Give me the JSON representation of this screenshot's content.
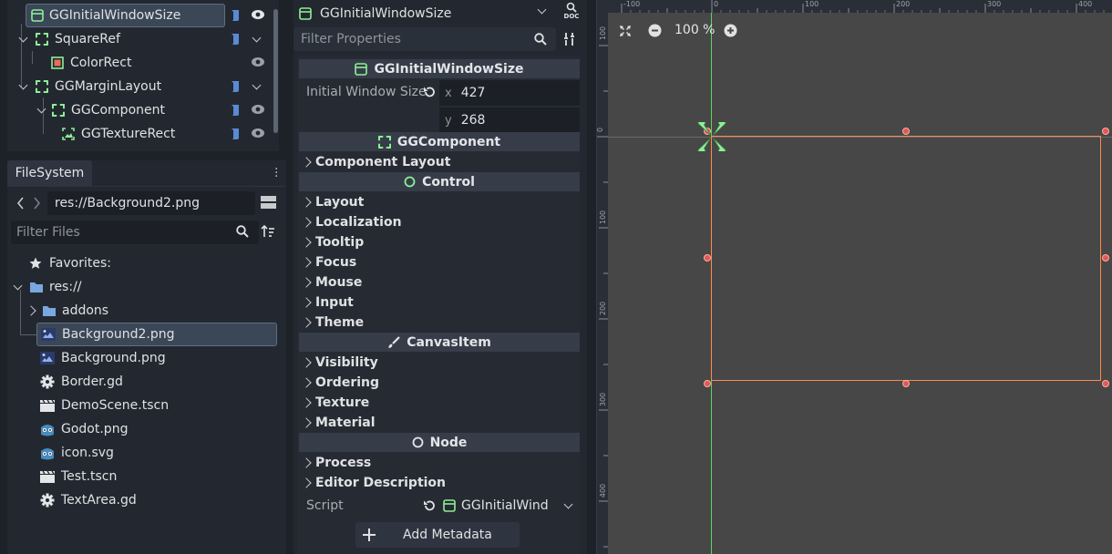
{
  "scene_tree": {
    "nodes": [
      {
        "label": "GGInitialWindowSize",
        "icon": "control-window-icon",
        "script": true,
        "visibility": "visible",
        "selected": true
      },
      {
        "label": "SquareRef",
        "icon": "ggcomponent-icon",
        "script": true,
        "fold": "collapsed"
      },
      {
        "label": "ColorRect",
        "icon": "colorrect-icon",
        "script": false,
        "visibility": "visible"
      },
      {
        "label": "GGMarginLayout",
        "icon": "ggcomponent-icon",
        "script": true,
        "fold": "collapsed"
      },
      {
        "label": "GGComponent",
        "icon": "ggcomponent-icon",
        "script": true,
        "visibility": "visible"
      },
      {
        "label": "GGTextureRect",
        "icon": "texturerect-icon",
        "script": true,
        "visibility": "visible"
      }
    ]
  },
  "filesystem": {
    "tab": "FileSystem",
    "path": "res://Background2.png",
    "filter_placeholder": "Filter Files",
    "favorites": "Favorites:",
    "root": "res://",
    "items": [
      {
        "label": "addons",
        "icon": "folder-icon"
      },
      {
        "label": "Background2.png",
        "icon": "image-icon",
        "selected": true
      },
      {
        "label": "Background.png",
        "icon": "image-icon"
      },
      {
        "label": "Border.gd",
        "icon": "gear-icon"
      },
      {
        "label": "DemoScene.tscn",
        "icon": "clapper-icon"
      },
      {
        "label": "Godot.png",
        "icon": "godot-icon"
      },
      {
        "label": "icon.svg",
        "icon": "godot-icon"
      },
      {
        "label": "Test.tscn",
        "icon": "clapper-icon"
      },
      {
        "label": "TextArea.gd",
        "icon": "gear-icon"
      }
    ]
  },
  "inspector": {
    "object": "GGInitialWindowSize",
    "doc_label": "DOC",
    "filter_placeholder": "Filter Properties",
    "section_main": "GGInitialWindowSize",
    "initial_window_size_label": "Initial Window Size",
    "size_x_label": "x",
    "size_x": "427",
    "size_y_label": "y",
    "size_y": "268",
    "section_ggcomponent": "GGComponent",
    "group_component_layout": "Component Layout",
    "section_control": "Control",
    "control_groups": [
      "Layout",
      "Localization",
      "Tooltip",
      "Focus",
      "Mouse",
      "Input",
      "Theme"
    ],
    "section_canvasitem": "CanvasItem",
    "canvas_groups": [
      "Visibility",
      "Ordering",
      "Texture",
      "Material"
    ],
    "section_node": "Node",
    "node_groups": [
      "Process",
      "Editor Description"
    ],
    "script_label": "Script",
    "script_value": "GGInitialWind",
    "add_metadata": "Add Metadata"
  },
  "viewport": {
    "zoom": "100 %",
    "ruler_top": [
      "-100",
      "0",
      "100",
      "200",
      "300",
      "400"
    ],
    "ruler_left": [
      "100",
      "0",
      "100",
      "200",
      "300",
      "400"
    ]
  },
  "colors": {
    "accent": "#4a90d9",
    "node_green": "#8eef97",
    "rect_outline": "#ff8a4a",
    "handle": "#e05858"
  }
}
